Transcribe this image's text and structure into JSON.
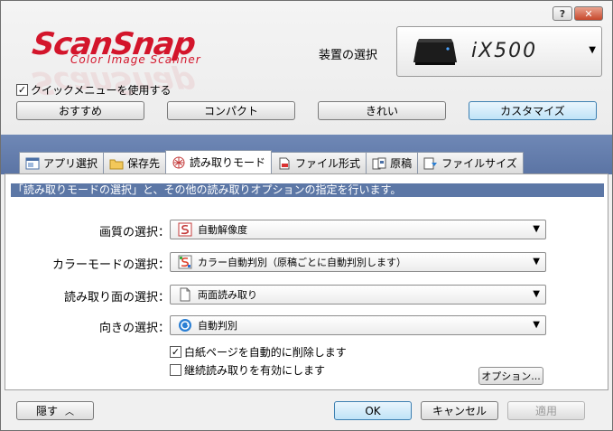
{
  "titlebar": {
    "help_label": "?",
    "close_label": "✕"
  },
  "logo": {
    "main": "ScanSnap",
    "sub": "Color Image Scanner"
  },
  "device": {
    "label": "装置の選択",
    "name": "iX500"
  },
  "quick_menu": {
    "label": "クイックメニューを使用する",
    "checked": true
  },
  "presets": [
    "おすすめ",
    "コンパクト",
    "きれい",
    "カスタマイズ"
  ],
  "tabs": [
    {
      "label": "アプリ選択",
      "icon": "application-icon"
    },
    {
      "label": "保存先",
      "icon": "folder-icon"
    },
    {
      "label": "読み取りモード",
      "icon": "scan-mode-icon",
      "active": true
    },
    {
      "label": "ファイル形式",
      "icon": "file-format-icon"
    },
    {
      "label": "原稿",
      "icon": "document-icon"
    },
    {
      "label": "ファイルサイズ",
      "icon": "file-size-icon"
    }
  ],
  "description": "「読み取りモードの選択」と、その他の読み取りオプションの指定を行います。",
  "settings": [
    {
      "label": "画質の選択：",
      "value": "自動解像度"
    },
    {
      "label": "カラーモードの選択：",
      "value": "カラー自動判別（原稿ごとに自動判別します）"
    },
    {
      "label": "読み取り面の選択：",
      "value": "両面読み取り"
    },
    {
      "label": "向きの選択：",
      "value": "自動判別"
    }
  ],
  "options": [
    {
      "label": "白紙ページを自動的に削除します",
      "checked": true
    },
    {
      "label": "継続読み取りを有効にします",
      "checked": false
    }
  ],
  "option_button": "オプション...",
  "footer": {
    "hide": "隠す",
    "ok": "OK",
    "cancel": "キャンセル",
    "apply": "適用"
  },
  "colors": {
    "accent_red": "#d3152b",
    "band_blue": "#5c77a6"
  }
}
